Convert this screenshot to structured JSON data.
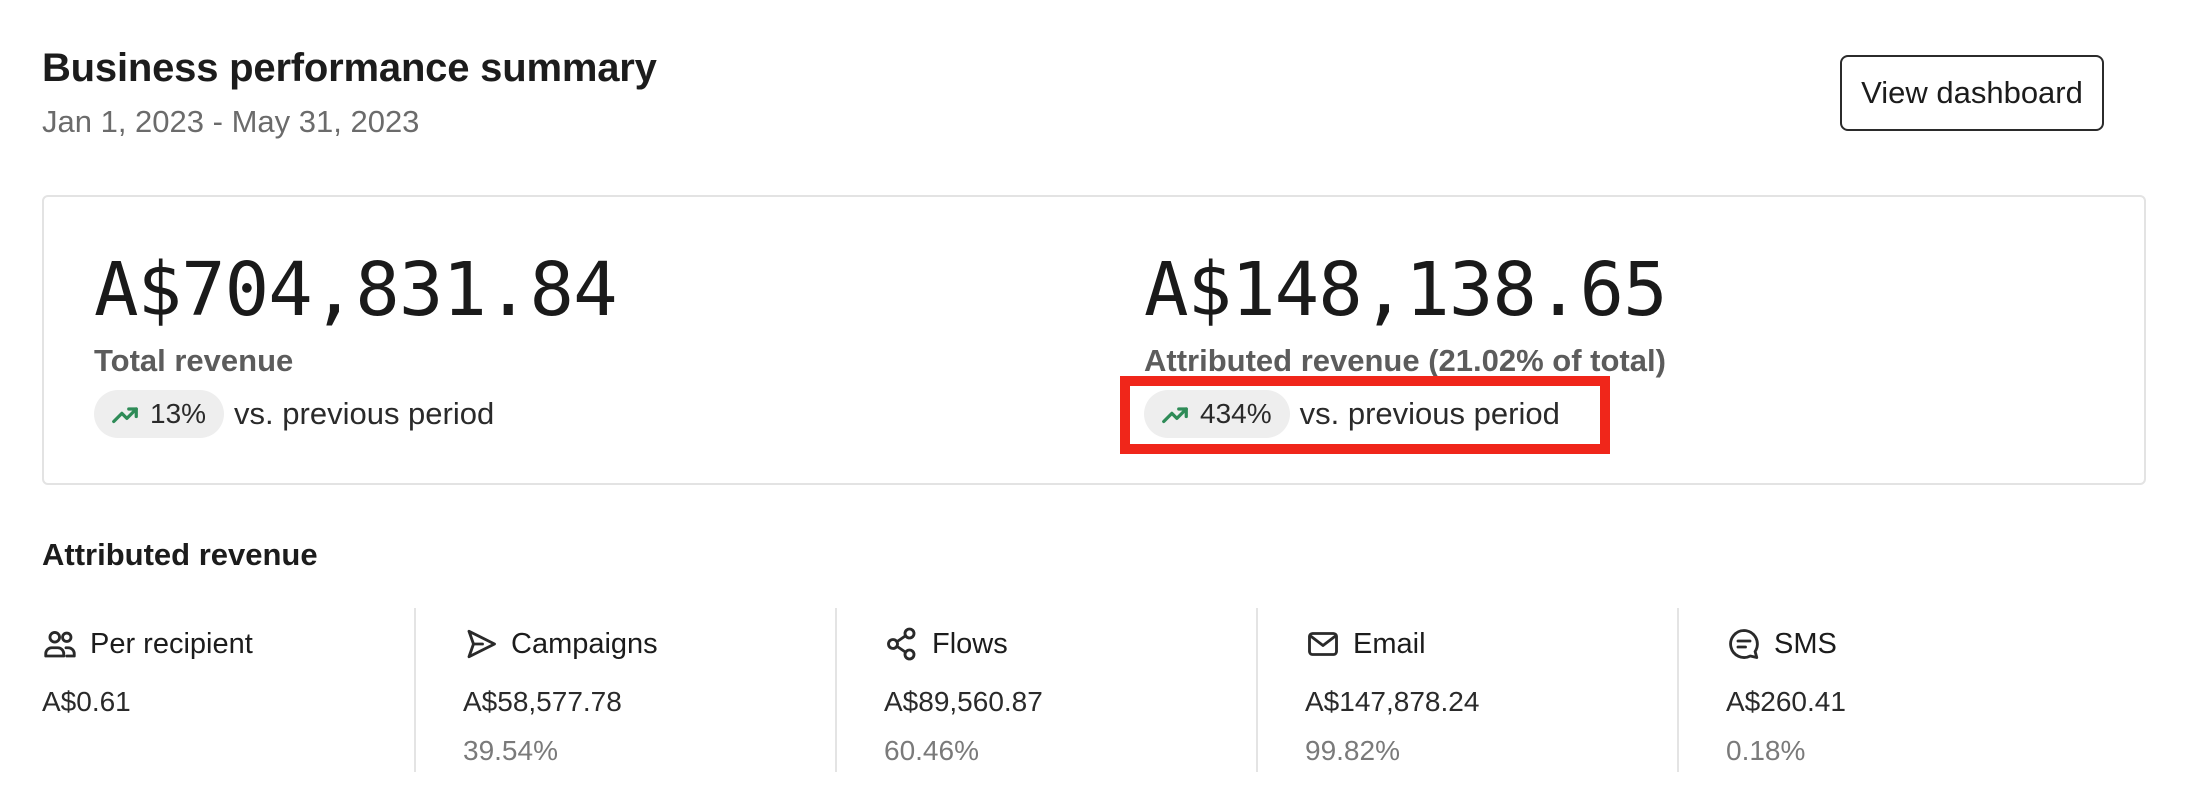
{
  "header": {
    "title": "Business performance summary",
    "date_range": "Jan 1, 2023 - May 31, 2023",
    "view_dashboard_label": "View dashboard"
  },
  "summary": {
    "total": {
      "value": "A$704,831.84",
      "label": "Total revenue",
      "delta": "13%",
      "delta_icon": "trending-up-icon",
      "comparison": "vs. previous period"
    },
    "attributed": {
      "value": "A$148,138.65",
      "label": "Attributed revenue (21.02% of total)",
      "delta": "434%",
      "delta_icon": "trending-up-icon",
      "comparison": "vs. previous period"
    }
  },
  "attributed_section": {
    "title": "Attributed revenue",
    "items": [
      {
        "icon": "people-icon",
        "label": "Per recipient",
        "value": "A$0.61",
        "share": ""
      },
      {
        "icon": "send-icon",
        "label": "Campaigns",
        "value": "A$58,577.78",
        "share": "39.54%"
      },
      {
        "icon": "share-nodes-icon",
        "label": "Flows",
        "value": "A$89,560.87",
        "share": "60.46%"
      },
      {
        "icon": "mail-icon",
        "label": "Email",
        "value": "A$147,878.24",
        "share": "99.82%"
      },
      {
        "icon": "chat-bubble-icon",
        "label": "SMS",
        "value": "A$260.41",
        "share": "0.18%"
      }
    ]
  },
  "colors": {
    "trend_up": "#2e8b57",
    "highlight": "#f0261a",
    "border": "#e3e3e3"
  }
}
